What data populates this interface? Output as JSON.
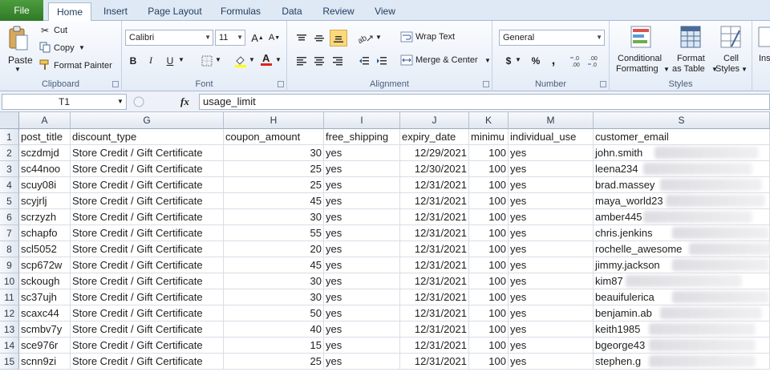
{
  "tabs": [
    "File",
    "Home",
    "Insert",
    "Page Layout",
    "Formulas",
    "Data",
    "Review",
    "View"
  ],
  "clipboard": {
    "paste": "Paste",
    "cut": "Cut",
    "copy": "Copy",
    "format_painter": "Format Painter",
    "label": "Clipboard"
  },
  "font": {
    "name": "Calibri",
    "size": "11",
    "bold": "B",
    "italic": "I",
    "underline": "U",
    "label": "Font"
  },
  "alignment": {
    "wrap_text": "Wrap Text",
    "merge_center": "Merge & Center",
    "label": "Alignment"
  },
  "number": {
    "format": "General",
    "currency": "$",
    "percent": "%",
    "comma": ",",
    "inc_decimal": ".0 .00",
    "dec_decimal": ".00 .0",
    "label": "Number"
  },
  "styles": {
    "conditional": [
      "Conditional",
      "Formatting"
    ],
    "format_table": [
      "Format",
      "as Table"
    ],
    "cell_styles": [
      "Cell",
      "Styles"
    ],
    "label": "Styles"
  },
  "insert_partial": "Ins",
  "formula_bar": {
    "cell_ref": "T1",
    "fx": "fx",
    "content": "usage_limit"
  },
  "columns": [
    "A",
    "G",
    "H",
    "I",
    "J",
    "K",
    "M",
    "S"
  ],
  "headers": [
    "post_title",
    "discount_type",
    "coupon_amount",
    "free_shipping",
    "expiry_date",
    "minimu",
    "individual_use",
    "customer_email"
  ],
  "rows": [
    {
      "num": "1"
    },
    {
      "num": "2",
      "cells": [
        "sczdmjd",
        "Store Credit / Gift Certificate",
        "30",
        "yes",
        "12/29/2021",
        "100",
        "yes",
        "john.smith"
      ]
    },
    {
      "num": "3",
      "cells": [
        "sc44noo",
        "Store Credit / Gift Certificate",
        "25",
        "yes",
        "12/30/2021",
        "100",
        "yes",
        "leena234"
      ]
    },
    {
      "num": "4",
      "cells": [
        "scuy08i",
        "Store Credit / Gift Certificate",
        "25",
        "yes",
        "12/31/2021",
        "100",
        "yes",
        "brad.massey"
      ]
    },
    {
      "num": "5",
      "cells": [
        "scyjrlj",
        "Store Credit / Gift Certificate",
        "45",
        "yes",
        "12/31/2021",
        "100",
        "yes",
        "maya_world23"
      ]
    },
    {
      "num": "6",
      "cells": [
        "scrzyzh",
        "Store Credit / Gift Certificate",
        "30",
        "yes",
        "12/31/2021",
        "100",
        "yes",
        "amber445"
      ]
    },
    {
      "num": "7",
      "cells": [
        "schapfo",
        "Store Credit / Gift Certificate",
        "55",
        "yes",
        "12/31/2021",
        "100",
        "yes",
        "chris.jenkins"
      ]
    },
    {
      "num": "8",
      "cells": [
        "scl5052",
        "Store Credit / Gift Certificate",
        "20",
        "yes",
        "12/31/2021",
        "100",
        "yes",
        "rochelle_awesome"
      ]
    },
    {
      "num": "9",
      "cells": [
        "scp672w",
        "Store Credit / Gift Certificate",
        "45",
        "yes",
        "12/31/2021",
        "100",
        "yes",
        "jimmy.jackson"
      ]
    },
    {
      "num": "10",
      "cells": [
        "sckough",
        "Store Credit / Gift Certificate",
        "30",
        "yes",
        "12/31/2021",
        "100",
        "yes",
        "kim87"
      ]
    },
    {
      "num": "11",
      "cells": [
        "sc37ujh",
        "Store Credit / Gift Certificate",
        "30",
        "yes",
        "12/31/2021",
        "100",
        "yes",
        "beauifulerica"
      ]
    },
    {
      "num": "12",
      "cells": [
        "scaxc44",
        "Store Credit / Gift Certificate",
        "50",
        "yes",
        "12/31/2021",
        "100",
        "yes",
        "benjamin.ab"
      ]
    },
    {
      "num": "13",
      "cells": [
        "scmbv7y",
        "Store Credit / Gift Certificate",
        "40",
        "yes",
        "12/31/2021",
        "100",
        "yes",
        "keith1985"
      ]
    },
    {
      "num": "14",
      "cells": [
        "sce976r",
        "Store Credit / Gift Certificate",
        "15",
        "yes",
        "12/31/2021",
        "100",
        "yes",
        "bgeorge43"
      ]
    },
    {
      "num": "15",
      "cells": [
        "scnn9zi",
        "Store Credit / Gift Certificate",
        "25",
        "yes",
        "12/31/2021",
        "100",
        "yes",
        "stephen.g"
      ]
    }
  ],
  "colors": {
    "file_tab": "#3a8a30",
    "ribbon_bg": "#e4ecf7",
    "selected_button": "#fbd97a",
    "grid_line": "#d8dde6"
  }
}
